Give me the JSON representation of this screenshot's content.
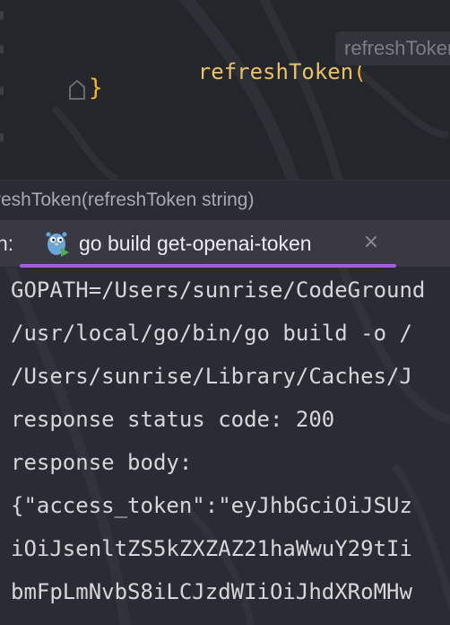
{
  "editor": {
    "function_call": "refreshToken",
    "open_paren": "(",
    "inlay_hint": "refreshToken",
    "closing_brace": "}"
  },
  "breadcrumb": {
    "text": "reshToken(refreshToken string)"
  },
  "run_panel": {
    "label": "n:",
    "tab_title": "go build get-openai-token",
    "close_glyph": "×",
    "accent_color": "#a35ee0"
  },
  "console": {
    "lines": [
      "GOPATH=/Users/sunrise/CodeGround",
      "/usr/local/go/bin/go build -o /",
      "/Users/sunrise/Library/Caches/J",
      "response status code: 200",
      "response body:",
      "{\"access_token\":\"eyJhbGciOiJSUz",
      "iOiJsenltZS5kZXZAZ21haWwuY29tIi",
      "bmFpLmNvbS8iLCJzdWIiOiJhdXRoMHw",
      "..."
    ]
  },
  "colors": {
    "editor_bg": "#25252c",
    "panel_bg": "#2b2b33",
    "function_color": "#e8c26b",
    "brace_color": "#f2b733"
  }
}
